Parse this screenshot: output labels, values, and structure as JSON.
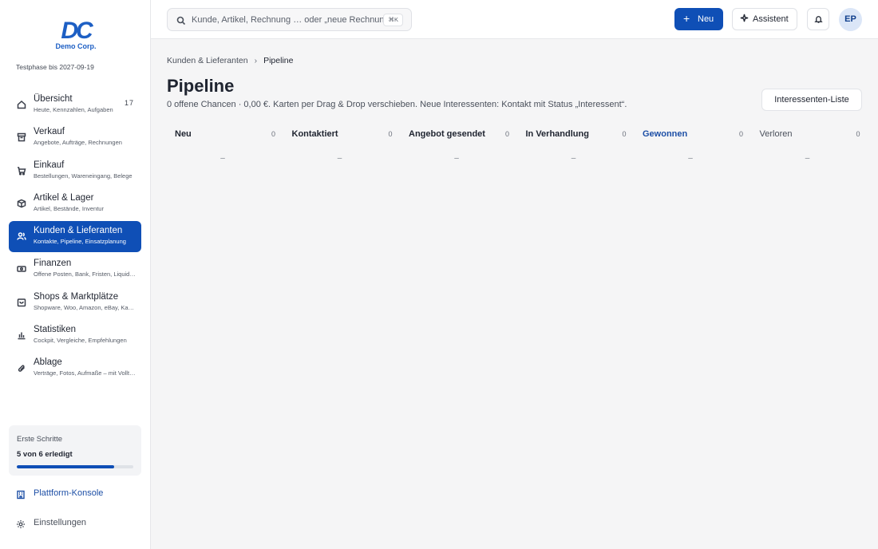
{
  "brand": {
    "mark": "DC",
    "name": "Demo Corp.",
    "trial": "Testphase bis 2027-09-19"
  },
  "sidebar": {
    "items": [
      {
        "label": "Übersicht",
        "sub": "Heute, Kennzahlen, Aufgaben",
        "count": "17",
        "icon": "home-icon"
      },
      {
        "label": "Verkauf",
        "sub": "Angebote, Aufträge, Rechnungen",
        "count": "",
        "icon": "archive-icon"
      },
      {
        "label": "Einkauf",
        "sub": "Bestellungen, Wareneingang, Belege",
        "count": "",
        "icon": "cart-icon"
      },
      {
        "label": "Artikel & Lager",
        "sub": "Artikel, Bestände, Inventur",
        "count": "",
        "icon": "box-icon"
      },
      {
        "label": "Kunden & Lieferanten",
        "sub": "Kontakte, Pipeline, Einsatzplanung",
        "count": "",
        "icon": "users-icon"
      },
      {
        "label": "Finanzen",
        "sub": "Offene Posten, Bank, Fristen, Liquidität",
        "count": "",
        "icon": "banknote-icon"
      },
      {
        "label": "Shops & Marktplätze",
        "sub": "Shopware, Woo, Amazon, eBay, Kaufland",
        "count": "",
        "icon": "store-icon"
      },
      {
        "label": "Statistiken",
        "sub": "Cockpit, Vergleiche, Empfehlungen",
        "count": "",
        "icon": "chart-icon"
      },
      {
        "label": "Ablage",
        "sub": "Verträge, Fotos, Aufmaße – mit Volltextsuche",
        "count": "",
        "icon": "paperclip-icon"
      }
    ],
    "active_index": 4,
    "steps": {
      "title": "Erste Schritte",
      "progress_text": "5 von 6 erledigt",
      "progress": 0.833
    },
    "platform_label": "Plattform-Konsole",
    "settings_label": "Einstellungen"
  },
  "header": {
    "search_placeholder": "Kunde, Artikel, Rechnung … oder „neue Rechnung für …“",
    "search_shortcut": "⌘K",
    "new_label": "Neu",
    "assistant_label": "Assistent",
    "avatar_initials": "EP"
  },
  "breadcrumb": {
    "parent": "Kunden & Lieferanten",
    "current": "Pipeline"
  },
  "page": {
    "title": "Pipeline",
    "subtitle": "0 offene Chancen · 0,00 €. Karten per Drag & Drop verschieben. Neue Interessenten: Kontakt mit Status „Interessent“.",
    "list_button": "Interessenten-Liste"
  },
  "pipeline": {
    "empty_marker": "–",
    "columns": [
      {
        "name": "Neu",
        "count": "0"
      },
      {
        "name": "Kontaktiert",
        "count": "0"
      },
      {
        "name": "Angebot gesendet",
        "count": "0"
      },
      {
        "name": "In Verhandlung",
        "count": "0"
      },
      {
        "name": "Gewonnen",
        "count": "0"
      },
      {
        "name": "Verloren",
        "count": "0"
      }
    ]
  },
  "colors": {
    "accent": "#0f4fb6",
    "won": "#1d4fa6",
    "background": "#f5f5f6"
  }
}
